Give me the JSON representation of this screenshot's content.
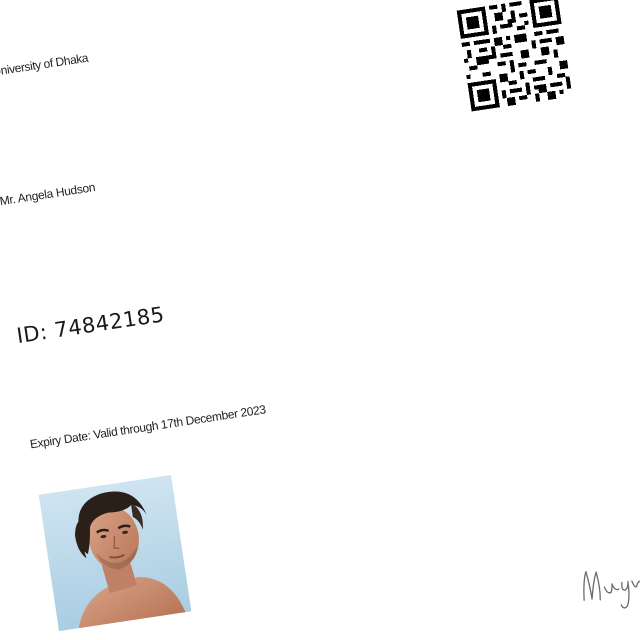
{
  "card": {
    "institution": "University of Dhaka",
    "holder_name": "Mr. Angela Hudson",
    "id_label": "ID: 74842185",
    "expiry_label": "Expiry Date: Valid through 17th December 2023"
  },
  "photo": {
    "icon": "portrait-photo",
    "background_color": "#bcd9ea"
  },
  "qr_code": {
    "icon": "qr-code-icon"
  },
  "signature": {
    "icon": "handwritten-signature",
    "ink_color": "#6b6b6b"
  },
  "colors": {
    "page_background": "#ffffff",
    "text": "#222222"
  }
}
